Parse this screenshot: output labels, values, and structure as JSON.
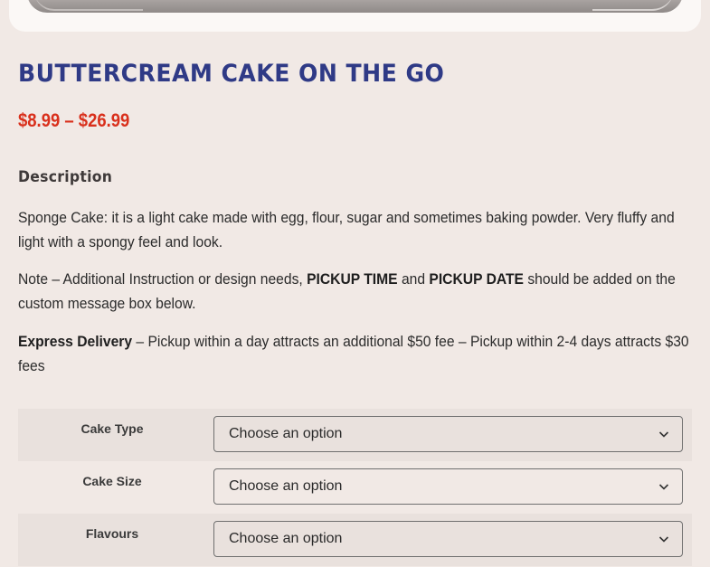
{
  "product": {
    "title": "Buttercream Cake on the go",
    "price_range": "$8.99 – $26.99",
    "description_heading": "Description",
    "description": {
      "p1": "Sponge Cake: it is a light cake made with egg, flour, sugar and sometimes baking powder. Very fluffy and light with a spongy feel and look.",
      "p2": {
        "before": "Note – Additional Instruction or design needs, ",
        "bold1": "PICKUP TIME",
        "mid": " and ",
        "bold2": "PICKUP DATE",
        "after": " should be added on the custom message box below."
      },
      "p3": {
        "bold": "Express Delivery",
        "text": " – Pickup within a day attracts an additional $50 fee – Pickup within 2-4 days attracts $30 fees"
      }
    }
  },
  "variations": [
    {
      "label": "Cake Type",
      "selected": "Choose an option"
    },
    {
      "label": "Cake Size",
      "selected": "Choose an option"
    },
    {
      "label": "Flavours",
      "selected": "Choose an option"
    }
  ],
  "colors": {
    "background": "#f1e9e5",
    "title": "#2f3a86",
    "price": "#d9301c"
  },
  "icons": {
    "select_arrow": "chevron-down-icon"
  }
}
